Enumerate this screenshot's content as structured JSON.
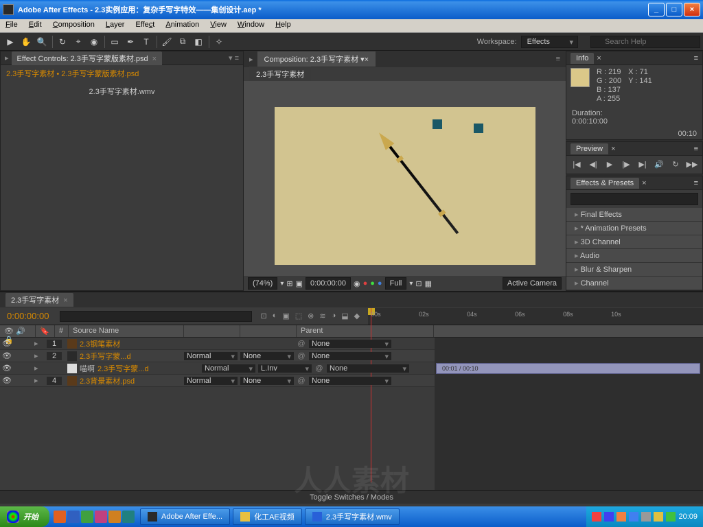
{
  "title": "Adobe After Effects - 2.3实例应用：复杂手写字特效——集创设计.aep *",
  "menu": [
    "File",
    "Edit",
    "Composition",
    "Layer",
    "Effect",
    "Animation",
    "View",
    "Window",
    "Help"
  ],
  "workspace": {
    "label": "Workspace:",
    "value": "Effects"
  },
  "helpSearch": "Search Help",
  "effectControls": {
    "tab": "Effect Controls: 2.3手写字蒙版素材.psd",
    "breadcrumb": "2.3手写字素材 • 2.3手写字蒙版素材.psd",
    "clip": "2.3手写字素材.wmv"
  },
  "composition": {
    "tab": "Composition: 2.3手写字素材",
    "sub": "2.3手写字素材",
    "zoom": "(74%)",
    "time": "0:00:00:00",
    "res": "Full",
    "camera": "Active Camera"
  },
  "info": {
    "title": "Info",
    "r": "R : 219",
    "g": "G : 200",
    "b": "B : 137",
    "a": "A : 255",
    "x": "X : 71",
    "y": "Y : 141",
    "durLabel": "Duration:",
    "dur": "0:00:10:00",
    "end": "00:10"
  },
  "preview": {
    "title": "Preview"
  },
  "effectsPresets": {
    "title": "Effects & Presets",
    "cats": [
      "Final Effects",
      "* Animation Presets",
      "3D Channel",
      "Audio",
      "Blur & Sharpen",
      "Channel"
    ]
  },
  "timeline": {
    "tab": "2.3手写字素材",
    "tc": "0:00:00:00",
    "cols": {
      "num": "#",
      "src": "Source Name",
      "parent": "Parent"
    },
    "toggle": "Toggle Switches / Modes",
    "ticks": [
      "00s",
      "02s",
      "04s",
      "06s",
      "08s",
      "10s"
    ],
    "trackLabel": "00:01 / 00:10",
    "layers": [
      {
        "idx": "1",
        "name": "2.3钢笔素材",
        "mode": "",
        "trk": "",
        "parent": "None",
        "y": true,
        "ico": "ps"
      },
      {
        "idx": "2",
        "name": "2.3手写字蒙...d",
        "mode": "Normal",
        "trk": "None",
        "parent": "None",
        "y": true,
        "ico": "dk"
      },
      {
        "idx": "",
        "name": "2.3手写字蒙...d",
        "mode": "Normal",
        "trk": "L.Inv",
        "parent": "None",
        "y": true,
        "ico": "wt",
        "pre": "喵啊"
      },
      {
        "idx": "4",
        "name": "2.3背景素材.psd",
        "mode": "Normal",
        "trk": "None",
        "parent": "None",
        "y": true,
        "ico": "ps"
      }
    ]
  },
  "taskbar": {
    "start": "开始",
    "items": [
      {
        "label": "Adobe After Effe...",
        "color": "#2a2a2a"
      },
      {
        "label": "化工AE视频",
        "color": "#e8c040"
      },
      {
        "label": "2.3手写字素材.wmv",
        "color": "#2860d8"
      }
    ],
    "clock": "20:09"
  }
}
